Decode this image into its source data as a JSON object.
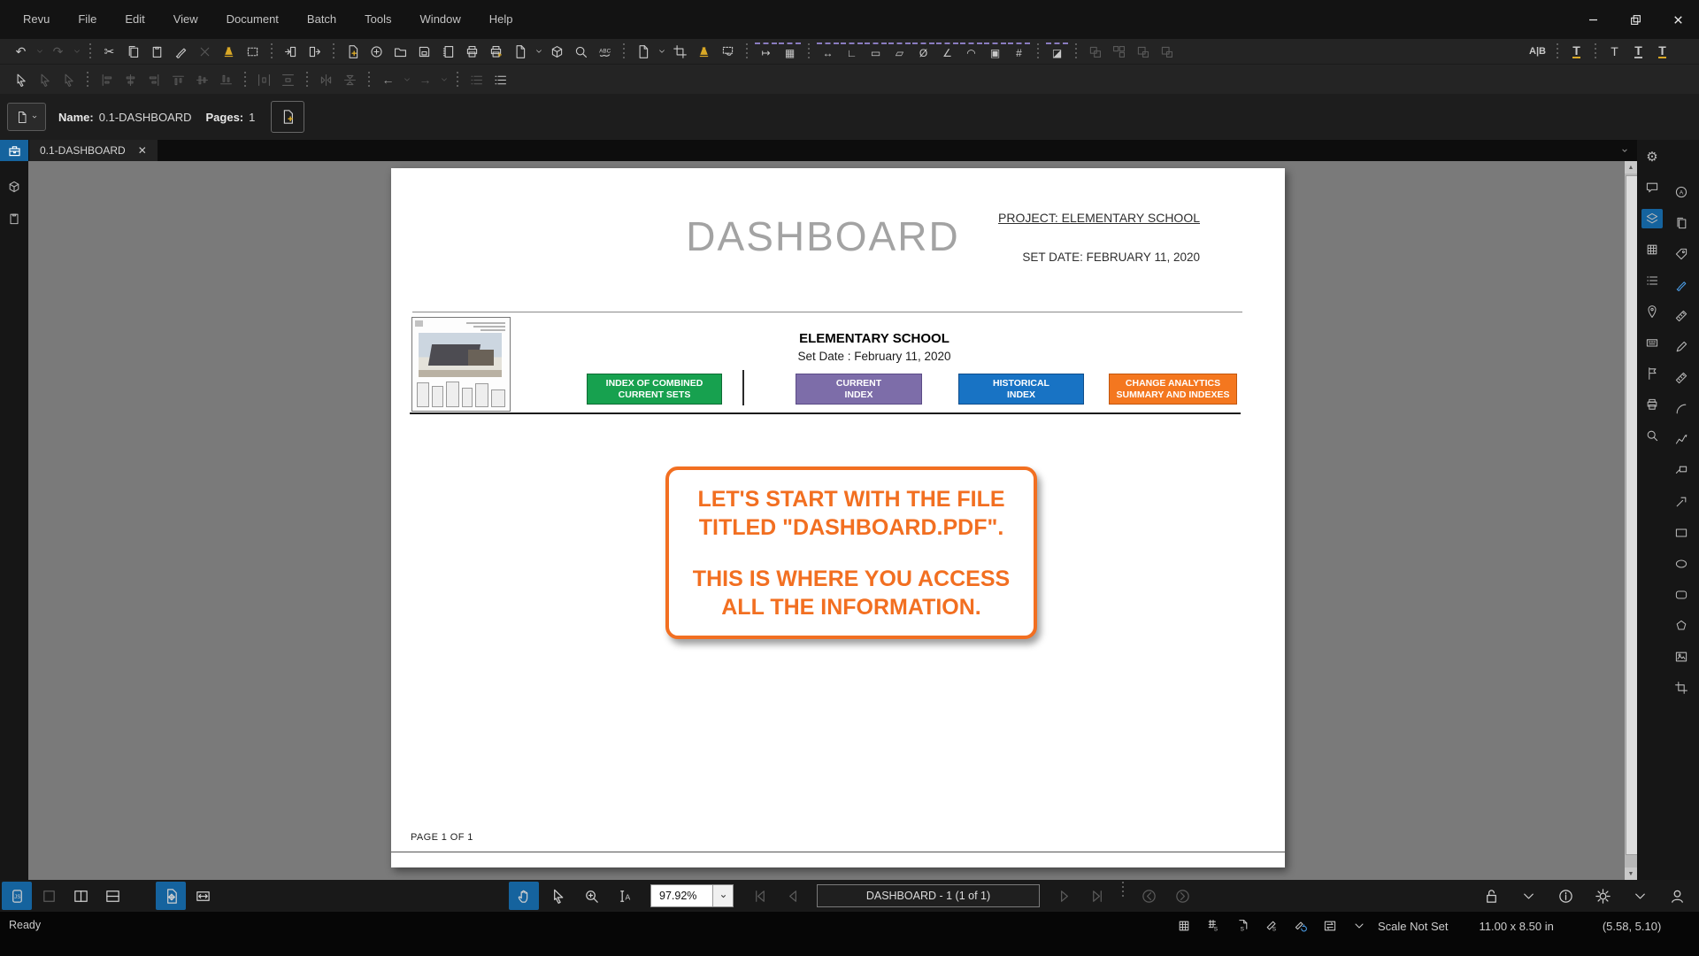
{
  "colors": {
    "accent_blue": "#15639E",
    "accent_yellow": "#D9A826",
    "accent_purple": "#8a7cc0",
    "callout_orange": "#F26F21",
    "viewport_gray": "#7a7a7a"
  },
  "titlebar": {
    "menus": [
      {
        "name": "revu",
        "label": "Revu"
      },
      {
        "name": "file",
        "label": "File"
      },
      {
        "name": "edit",
        "label": "Edit"
      },
      {
        "name": "view",
        "label": "View"
      },
      {
        "name": "document",
        "label": "Document"
      },
      {
        "name": "batch",
        "label": "Batch"
      },
      {
        "name": "tools",
        "label": "Tools"
      },
      {
        "name": "window",
        "label": "Window"
      },
      {
        "name": "help",
        "label": "Help"
      }
    ],
    "window_controls": [
      "minimize",
      "restore",
      "close"
    ]
  },
  "toolbar_row1": [
    {
      "n": "undo",
      "t": "↶"
    },
    {
      "n": "undo-menu",
      "k": "chev",
      "sm": 1,
      "d": 1
    },
    {
      "n": "redo",
      "t": "↷",
      "d": 1
    },
    {
      "n": "redo-menu",
      "k": "chev",
      "sm": 1,
      "d": 1
    },
    {
      "sep": 1
    },
    {
      "n": "cut",
      "t": "✂"
    },
    {
      "n": "copy",
      "k": "pages"
    },
    {
      "n": "paste",
      "k": "clipboard"
    },
    {
      "n": "format-painter",
      "k": "brush"
    },
    {
      "n": "delete",
      "k": "close",
      "d": 1
    },
    {
      "n": "flatten",
      "k": "bell",
      "c": "#D9A826"
    },
    {
      "n": "snapshot",
      "k": "snapshot"
    },
    {
      "sep": 1
    },
    {
      "n": "insert-pages",
      "k": "pagein"
    },
    {
      "n": "extract-pages",
      "k": "pageout"
    },
    {
      "sep": 1
    },
    {
      "n": "new-pdf",
      "k": "fileplus"
    },
    {
      "n": "create-pdf",
      "k": "circleplus"
    },
    {
      "n": "open-file",
      "k": "folder"
    },
    {
      "n": "save-file",
      "k": "floppy"
    },
    {
      "n": "studio-binder",
      "k": "book"
    },
    {
      "n": "print",
      "k": "print"
    },
    {
      "n": "batch-print",
      "k": "printplus"
    },
    {
      "n": "export",
      "k": "page"
    },
    {
      "n": "export-menu",
      "k": "chev",
      "sm": 1
    },
    {
      "n": "pdf-3d",
      "k": "cube"
    },
    {
      "n": "search",
      "k": "search"
    },
    {
      "n": "spellcheck",
      "k": "abc"
    },
    {
      "sep": 1
    },
    {
      "n": "page-template",
      "k": "page"
    },
    {
      "n": "page-template-menu",
      "k": "chev",
      "sm": 1
    },
    {
      "n": "crop-pages",
      "k": "crop"
    },
    {
      "n": "flatten-markups",
      "k": "bell",
      "c": "#D9A826"
    },
    {
      "n": "lasso",
      "k": "lasso"
    },
    {
      "sep": 1
    },
    {
      "n": "calibrate",
      "m": "↦"
    },
    {
      "n": "viewports",
      "m": "▦"
    },
    {
      "sep": 1
    },
    {
      "n": "measure-length",
      "m": "↔"
    },
    {
      "n": "measure-polylength",
      "m": "∟"
    },
    {
      "n": "measure-perimeter",
      "m": "▭"
    },
    {
      "n": "measure-area",
      "m": "▱"
    },
    {
      "n": "measure-diameter",
      "m": "Ø"
    },
    {
      "n": "measure-angle",
      "m": "∠"
    },
    {
      "n": "measure-radius",
      "m": "◠"
    },
    {
      "n": "measure-volume",
      "m": "▣"
    },
    {
      "n": "measure-count",
      "m": "#"
    },
    {
      "sep": 1
    },
    {
      "n": "measure-cutout",
      "m": "◪"
    },
    {
      "sep": 1
    },
    {
      "n": "group",
      "k": "group",
      "d": 1
    },
    {
      "n": "ungroup",
      "k": "ungroup",
      "d": 1
    },
    {
      "n": "bring-to-front",
      "k": "front",
      "d": 1
    },
    {
      "n": "send-to-back",
      "k": "back",
      "d": 1
    }
  ],
  "toolbar_row1_right": [
    {
      "n": "compare-documents",
      "t": "A|B"
    },
    {
      "sep": 1
    },
    {
      "n": "highlight-text",
      "t": "T",
      "u": "#D9A826"
    },
    {
      "sep": 1
    },
    {
      "n": "typewriter-text",
      "t": "T"
    },
    {
      "n": "underline-text",
      "t": "T",
      "u": "#b5b5b5"
    },
    {
      "n": "strikeout-text",
      "t": "T",
      "u": "#D9A826"
    }
  ],
  "toolbar_row2": [
    {
      "n": "select",
      "k": "cursor"
    },
    {
      "n": "multi-select",
      "k": "cursor",
      "d": 1
    },
    {
      "n": "lasso-select",
      "k": "cursor",
      "d": 1
    },
    {
      "sep": 1
    },
    {
      "n": "align-left",
      "k": "alignl",
      "d": 1
    },
    {
      "n": "align-center",
      "k": "alignc",
      "d": 1
    },
    {
      "n": "align-right",
      "k": "alignr",
      "d": 1
    },
    {
      "n": "align-top",
      "k": "alignt",
      "d": 1
    },
    {
      "n": "align-middle",
      "k": "alignm",
      "d": 1
    },
    {
      "n": "align-bottom",
      "k": "alignb",
      "d": 1
    },
    {
      "sep": 1
    },
    {
      "n": "distribute-horizontal",
      "k": "disth",
      "d": 1
    },
    {
      "n": "distribute-vertical",
      "k": "distv",
      "d": 1
    },
    {
      "sep": 1
    },
    {
      "n": "flip-horizontal",
      "k": "fliph",
      "d": 1
    },
    {
      "n": "flip-vertical",
      "k": "flipv",
      "d": 1
    },
    {
      "sep": 1
    },
    {
      "n": "previous-markup",
      "t": "←",
      "c": "#9a9a9a"
    },
    {
      "n": "previous-markup-menu",
      "k": "chev",
      "sm": 1,
      "d": 1
    },
    {
      "n": "next-markup",
      "t": "→",
      "d": 1
    },
    {
      "n": "next-markup-menu",
      "k": "chev",
      "sm": 1,
      "d": 1
    },
    {
      "sep": 1
    },
    {
      "n": "hatch-pattern",
      "k": "listicon",
      "d": 1
    },
    {
      "n": "line-weight",
      "k": "listicon"
    }
  ],
  "name_bar": {
    "name_label": "Name:",
    "name_value": "0.1-DASHBOARD",
    "pages_label": "Pages:",
    "pages_value": "1"
  },
  "tab_bar": {
    "active_tab_label": "0.1-DASHBOARD",
    "close_glyph": "✕"
  },
  "left_rail": [
    {
      "n": "tool-chest",
      "k": "cube"
    },
    {
      "n": "markup-summary",
      "k": "clipboard"
    }
  ],
  "right_rail": {
    "col_a": [
      {
        "n": "settings",
        "t": "⚙"
      },
      {
        "n": "markup-chat",
        "k": "bubble"
      },
      {
        "n": "layers",
        "k": "layers",
        "bg": 1
      },
      {
        "n": "thumbnails",
        "k": "grid"
      },
      {
        "n": "markups-list",
        "k": "listicon"
      },
      {
        "n": "places",
        "k": "pin"
      },
      {
        "n": "form-fields",
        "k": "keyb"
      },
      {
        "n": "flags",
        "k": "flagicon"
      },
      {
        "n": "print-summary",
        "k": "print"
      },
      {
        "n": "search-panel",
        "k": "search"
      }
    ],
    "col_b": [
      {
        "n": "properties",
        "k": "circleA"
      },
      {
        "n": "file-access",
        "k": "pages"
      },
      {
        "n": "tags",
        "k": "tag"
      },
      {
        "n": "marker-tool",
        "k": "brush",
        "c": "#4C9EE8"
      },
      {
        "n": "measure-tool",
        "k": "ruler"
      },
      {
        "n": "pencil-tool",
        "k": "pencil"
      },
      {
        "n": "calibrate-tool",
        "k": "ruler"
      },
      {
        "n": "arc-tool",
        "k": "arc"
      },
      {
        "n": "polyline-tool",
        "k": "polyline"
      },
      {
        "n": "callout-tool",
        "k": "callouttool"
      },
      {
        "n": "arrow-tool",
        "k": "pinarrow"
      },
      {
        "n": "rectangle-tool",
        "k": "recticon"
      },
      {
        "n": "ellipse-tool",
        "k": "ellipseicon"
      },
      {
        "n": "snapshot-tool",
        "k": "roundrect"
      },
      {
        "n": "polygon-tool",
        "k": "polygonicon"
      },
      {
        "n": "image-tool",
        "k": "imageicon"
      },
      {
        "n": "crop-tool",
        "k": "croptool"
      }
    ]
  },
  "document": {
    "title": "DASHBOARD",
    "project_line": "PROJECT: ELEMENTARY SCHOOL",
    "set_date_header": "SET DATE: FEBRUARY 11, 2020",
    "school_name": "ELEMENTARY SCHOOL",
    "school_set_date": "Set Date : February 11, 2020",
    "buttons": [
      {
        "line1": "INDEX OF COMBINED",
        "line2": "CURRENT SETS",
        "fill": "#17A14F",
        "border": "#0E6B34"
      },
      {
        "line1": "CURRENT",
        "line2": "INDEX",
        "fill": "#7D6DA9",
        "border": "#5B4B86"
      },
      {
        "line1": "HISTORICAL",
        "line2": "INDEX",
        "fill": "#1873C4",
        "border": "#0F4E8C"
      },
      {
        "line1": "CHANGE ANALYTICS",
        "line2": "SUMMARY AND INDEXES",
        "fill": "#F4771F",
        "border": "#C1560E"
      }
    ],
    "callout": {
      "line1": "LET'S START WITH THE FILE TITLED \"DASHBOARD.PDF\".",
      "line2": "THIS IS WHERE YOU ACCESS ALL THE INFORMATION.",
      "border_color": "#F26F21"
    },
    "page_footer": "PAGE 1 OF 1"
  },
  "nav_bar": {
    "left_icons": [
      {
        "n": "javascript-console",
        "k": "js",
        "bg": 1
      },
      {
        "n": "single-page-view",
        "k": "pane",
        "d": 1
      },
      {
        "n": "split-vertical",
        "k": "splitv"
      },
      {
        "n": "split-horizontal",
        "k": "splith"
      },
      {
        "gap": 1
      },
      {
        "n": "pan-page",
        "k": "panpage",
        "bg": 1
      },
      {
        "n": "fit-width",
        "k": "fitw"
      }
    ],
    "tool_icons": [
      {
        "n": "pan-tool",
        "k": "hand",
        "bg": 1
      },
      {
        "n": "select-tool",
        "k": "cursor"
      },
      {
        "n": "zoom-tool",
        "k": "zoomplus"
      },
      {
        "n": "select-text-tool",
        "k": "textsel"
      }
    ],
    "zoom_value": "97.92%",
    "page_display": "DASHBOARD - 1 (1 of 1)",
    "nav_icons_before": [
      {
        "n": "first-page",
        "k": "first",
        "d": 1
      },
      {
        "n": "previous-page",
        "k": "prev",
        "d": 1
      }
    ],
    "nav_icons_after": [
      {
        "n": "next-page",
        "k": "next",
        "d": 1
      },
      {
        "n": "last-page",
        "k": "last",
        "d": 1
      },
      {
        "sep": 1
      },
      {
        "n": "previous-view",
        "k": "cback",
        "d": 1
      },
      {
        "n": "next-view",
        "k": "cfwd",
        "d": 1
      }
    ],
    "right_icons": [
      {
        "n": "lock",
        "k": "lock"
      },
      {
        "n": "lock-menu",
        "k": "chev",
        "sm": 1
      },
      {
        "n": "document-info",
        "k": "info"
      },
      {
        "n": "brightness",
        "k": "sun"
      },
      {
        "n": "brightness-menu",
        "k": "chev",
        "sm": 1
      },
      {
        "n": "profile",
        "k": "person"
      },
      {
        "n": "profile-menu",
        "k": "chev",
        "sm": 1
      }
    ]
  },
  "status_bar": {
    "ready_label": "Ready",
    "icons": [
      {
        "n": "show-grid",
        "k": "grid"
      },
      {
        "n": "snap-to-grid",
        "k": "gridS"
      },
      {
        "n": "reuse-markup",
        "k": "pageS"
      },
      {
        "n": "sync-markups",
        "k": "penS"
      },
      {
        "n": "pen-sync",
        "k": "penSync"
      },
      {
        "n": "swap-view",
        "k": "swap"
      },
      {
        "n": "scale-menu",
        "k": "chev",
        "sm": 1
      }
    ],
    "scale_label": "Scale Not Set",
    "page_size": "11.00 x 8.50 in",
    "cursor_coords": "(5.58, 5.10)"
  }
}
